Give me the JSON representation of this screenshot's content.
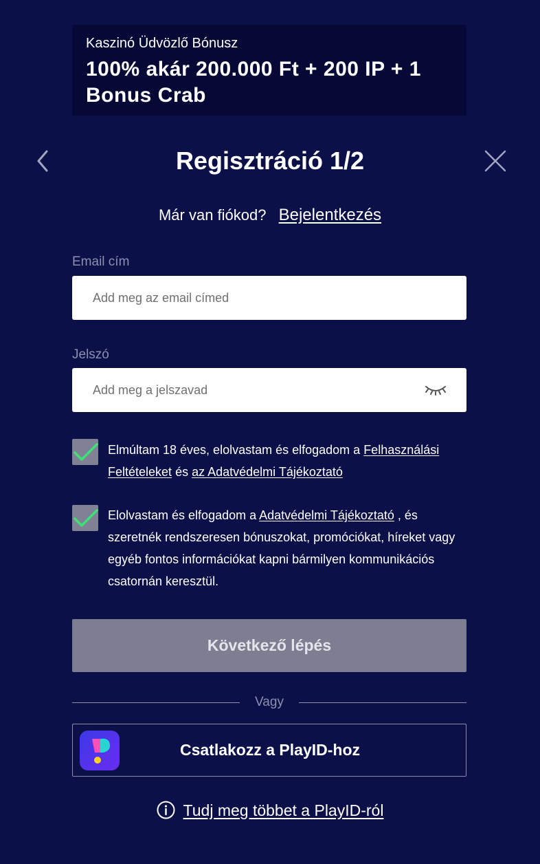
{
  "banner": {
    "subtitle": "Kaszinó Üdvözlő Bónusz",
    "title": "100% akár 200.000 Ft + 200 IP + 1 Bonus Crab"
  },
  "header": {
    "title": "Regisztráció 1/2"
  },
  "login": {
    "prompt": "Már van fiókod?",
    "link": "Bejelentkezés"
  },
  "email": {
    "label": "Email cím",
    "placeholder": "Add meg az email címed",
    "value": ""
  },
  "password": {
    "label": "Jelszó",
    "placeholder": "Add meg a jelszavad",
    "value": ""
  },
  "consents": [
    {
      "checked": true,
      "text_before": "Elmúltam 18 éves, elolvastam és elfogadom a ",
      "link1": "Felhasználási Feltételeket",
      "text_middle": " és ",
      "link2": "az Adatvédelmi Tájékoztató"
    },
    {
      "checked": true,
      "text_before": "Elolvastam és elfogadom a ",
      "link1": "Adatvédelmi Tájékoztató",
      "text_after": " , és szeretnék rendszeresen bónuszokat, promóciókat, híreket vagy egyéb fontos információkat kapni bármilyen kommunikációs csatornán keresztül."
    }
  ],
  "next_button": {
    "label": "Következő lépés"
  },
  "divider": {
    "label": "Vagy"
  },
  "playid": {
    "label": "Csatlakozz a PlayID-hoz"
  },
  "learn_more": {
    "label": "Tudj meg többet a PlayID-ról"
  },
  "colors": {
    "background": "#0c1049",
    "banner": "#060935",
    "checkbox": "#818196",
    "checkmark": "#3ee07a",
    "button_disabled": "#7e7e92"
  },
  "icons": {
    "back": "chevron-left-icon",
    "close": "close-icon",
    "password_toggle": "eye-closed-icon",
    "checkbox": "check-icon",
    "playid": "playid-logo-icon",
    "info": "info-icon"
  }
}
